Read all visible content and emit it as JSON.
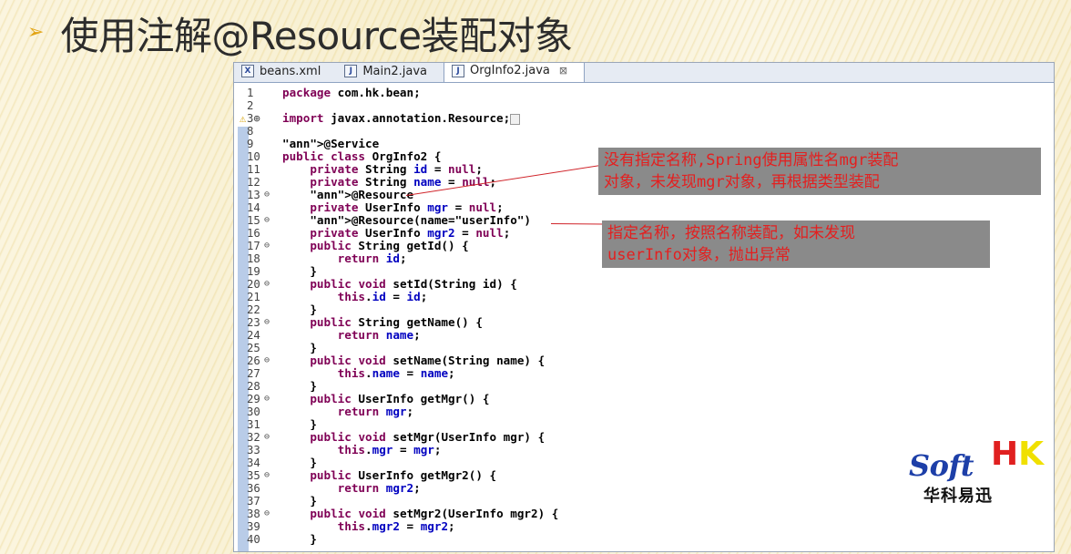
{
  "slide": {
    "bullet": "➢",
    "title": "使用注解@Resource装配对象"
  },
  "tabs": [
    {
      "icon": "X",
      "label": "beans.xml"
    },
    {
      "icon": "J",
      "label": "Main2.java"
    },
    {
      "icon": "J",
      "label": "OrgInfo2.java",
      "close": "⊠"
    }
  ],
  "code": [
    {
      "n": "1",
      "fold": "",
      "text": "package com.hk.bean;"
    },
    {
      "n": "2",
      "fold": "",
      "text": ""
    },
    {
      "n": "3⊕",
      "fold": "",
      "text": "import javax.annotation.Resource;"
    },
    {
      "n": "8",
      "fold": "",
      "text": ""
    },
    {
      "n": "9",
      "fold": "",
      "text": "@Service"
    },
    {
      "n": "10",
      "fold": "",
      "text": "public class OrgInfo2 {"
    },
    {
      "n": "11",
      "fold": "",
      "text": "    private String id = null;"
    },
    {
      "n": "12",
      "fold": "",
      "text": "    private String name = null;"
    },
    {
      "n": "13",
      "fold": "⊖",
      "text": "    @Resource"
    },
    {
      "n": "14",
      "fold": "",
      "text": "    private UserInfo mgr = null;"
    },
    {
      "n": "15",
      "fold": "⊖",
      "text": "    @Resource(name=\"userInfo\")"
    },
    {
      "n": "16",
      "fold": "",
      "text": "    private UserInfo mgr2 = null;"
    },
    {
      "n": "17",
      "fold": "⊖",
      "text": "    public String getId() {"
    },
    {
      "n": "18",
      "fold": "",
      "text": "        return id;"
    },
    {
      "n": "19",
      "fold": "",
      "text": "    }"
    },
    {
      "n": "20",
      "fold": "⊖",
      "text": "    public void setId(String id) {"
    },
    {
      "n": "21",
      "fold": "",
      "text": "        this.id = id;"
    },
    {
      "n": "22",
      "fold": "",
      "text": "    }"
    },
    {
      "n": "23",
      "fold": "⊖",
      "text": "    public String getName() {"
    },
    {
      "n": "24",
      "fold": "",
      "text": "        return name;"
    },
    {
      "n": "25",
      "fold": "",
      "text": "    }"
    },
    {
      "n": "26",
      "fold": "⊖",
      "text": "    public void setName(String name) {"
    },
    {
      "n": "27",
      "fold": "",
      "text": "        this.name = name;"
    },
    {
      "n": "28",
      "fold": "",
      "text": "    }"
    },
    {
      "n": "29",
      "fold": "⊖",
      "text": "    public UserInfo getMgr() {"
    },
    {
      "n": "30",
      "fold": "",
      "text": "        return mgr;"
    },
    {
      "n": "31",
      "fold": "",
      "text": "    }"
    },
    {
      "n": "32",
      "fold": "⊖",
      "text": "    public void setMgr(UserInfo mgr) {"
    },
    {
      "n": "33",
      "fold": "",
      "text": "        this.mgr = mgr;"
    },
    {
      "n": "34",
      "fold": "",
      "text": "    }"
    },
    {
      "n": "35",
      "fold": "⊖",
      "text": "    public UserInfo getMgr2() {"
    },
    {
      "n": "36",
      "fold": "",
      "text": "        return mgr2;"
    },
    {
      "n": "37",
      "fold": "",
      "text": "    }"
    },
    {
      "n": "38",
      "fold": "⊖",
      "text": "    public void setMgr2(UserInfo mgr2) {"
    },
    {
      "n": "39",
      "fold": "",
      "text": "        this.mgr2 = mgr2;"
    },
    {
      "n": "40",
      "fold": "",
      "text": "    }"
    }
  ],
  "callouts": [
    {
      "line1": "没有指定名称,Spring使用属性名mgr装配",
      "line2": "对象，未发现mgr对象，再根据类型装配"
    },
    {
      "line1": "指定名称，按照名称装配，如未发现",
      "line2": "userInfo对象，抛出异常"
    }
  ],
  "logo": {
    "soft": "Soft",
    "h": "H",
    "k": "K",
    "cn": "华科易迅"
  }
}
